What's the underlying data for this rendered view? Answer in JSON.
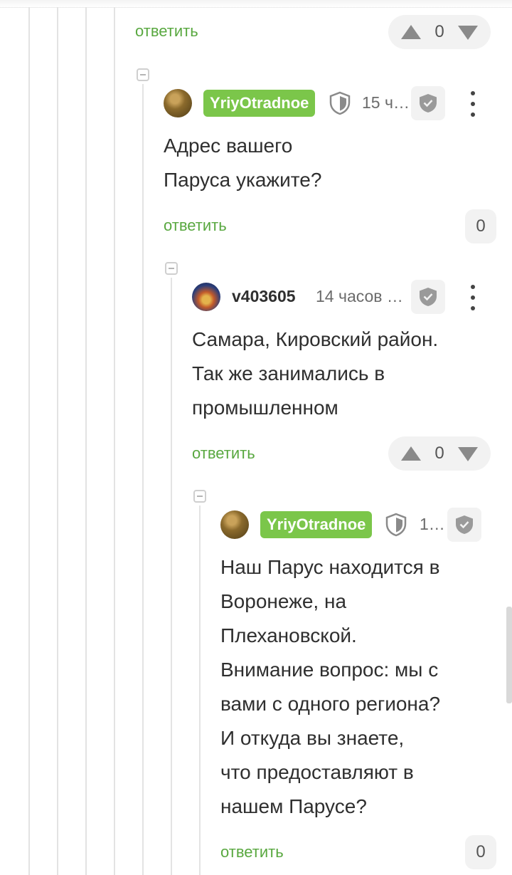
{
  "reply_label": "ответить",
  "colors": {
    "accent": "#59a840",
    "badge": "#7bc64a"
  },
  "top_bar": {
    "reply": "ответить",
    "votes": "0"
  },
  "comment1": {
    "username": "YriyOtradnoe",
    "time": "15 ч…",
    "line1": "Адрес вашего",
    "line2": "Паруса укажите?",
    "reply": "ответить",
    "votes": "0"
  },
  "comment2": {
    "username": "v403605",
    "time": "14 часов …",
    "line1": "Самара, Кировский район.",
    "line2": "Так же занимались в",
    "line3": "промышленном",
    "reply": "ответить",
    "votes": "0"
  },
  "comment3": {
    "username": "YriyOtradnoe",
    "time": "1…",
    "lines": [
      "Наш Парус находится в",
      "Воронеже, на",
      "Плехановской.",
      "Внимание вопрос: мы с",
      "вами с одного региона?",
      "И откуда вы знаете,",
      "что предоставляют в",
      "нашем Парусе?"
    ],
    "reply": "ответить",
    "votes": "0"
  },
  "icons": [
    "collapse-icon",
    "shield-icon",
    "shield-check-icon",
    "more-vert-icon",
    "arrow-up-icon",
    "arrow-down-icon"
  ]
}
